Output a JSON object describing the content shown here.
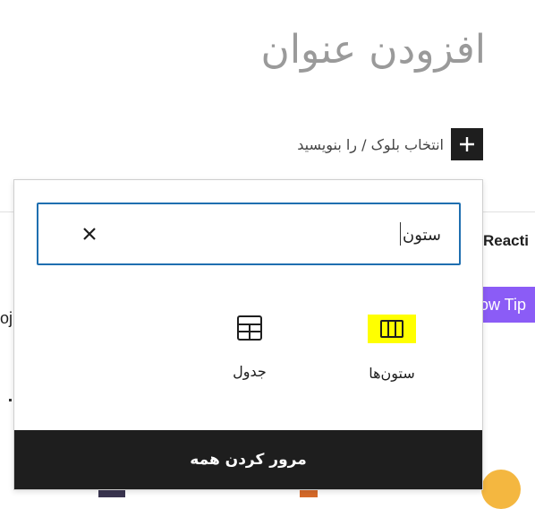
{
  "editor": {
    "title_placeholder": "افزودن عنوان",
    "block_hint": "انتخاب بلوک / را بنویسید",
    "add_block_icon": "plus-icon"
  },
  "background": {
    "heading_fragment": "Reacti",
    "button_fragment": "ow Tip",
    "text_fragment": "oj"
  },
  "inserter": {
    "search": {
      "value": "ستون",
      "clear_icon": "close-icon"
    },
    "results": [
      {
        "label": "ستون‌ها",
        "icon": "columns-icon",
        "highlighted": true
      },
      {
        "label": "جدول",
        "icon": "table-icon",
        "highlighted": false
      }
    ],
    "highlight_color": "#ffff00",
    "browse_all_label": "مرور کردن همه"
  }
}
